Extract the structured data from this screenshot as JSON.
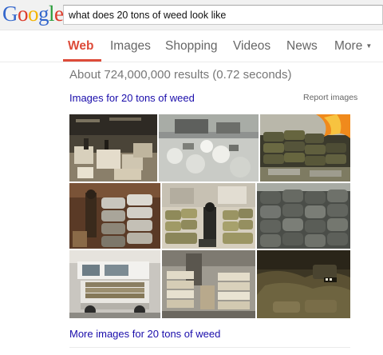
{
  "logo": {
    "letters": [
      "G",
      "o",
      "o",
      "g",
      "l",
      "e"
    ],
    "colors": [
      "#3366cc",
      "#dd3b2a",
      "#f4b400",
      "#3366cc",
      "#2a9d3b",
      "#dd3b2a"
    ]
  },
  "search": {
    "query": "what does 20 tons of weed look like"
  },
  "tabs": [
    {
      "label": "Web",
      "active": true
    },
    {
      "label": "Images",
      "active": false
    },
    {
      "label": "Shopping",
      "active": false
    },
    {
      "label": "Videos",
      "active": false
    },
    {
      "label": "News",
      "active": false
    },
    {
      "label": "More",
      "active": false
    }
  ],
  "results": {
    "count_text": "About 724,000,000 results (0.72 seconds)",
    "images_header_link": "Images for 20 tons of weed",
    "report_link": "Report images",
    "more_images_link": "More images for 20 tons of weed"
  },
  "accent_color": "#dd4b39",
  "link_color": "#1a0dab"
}
